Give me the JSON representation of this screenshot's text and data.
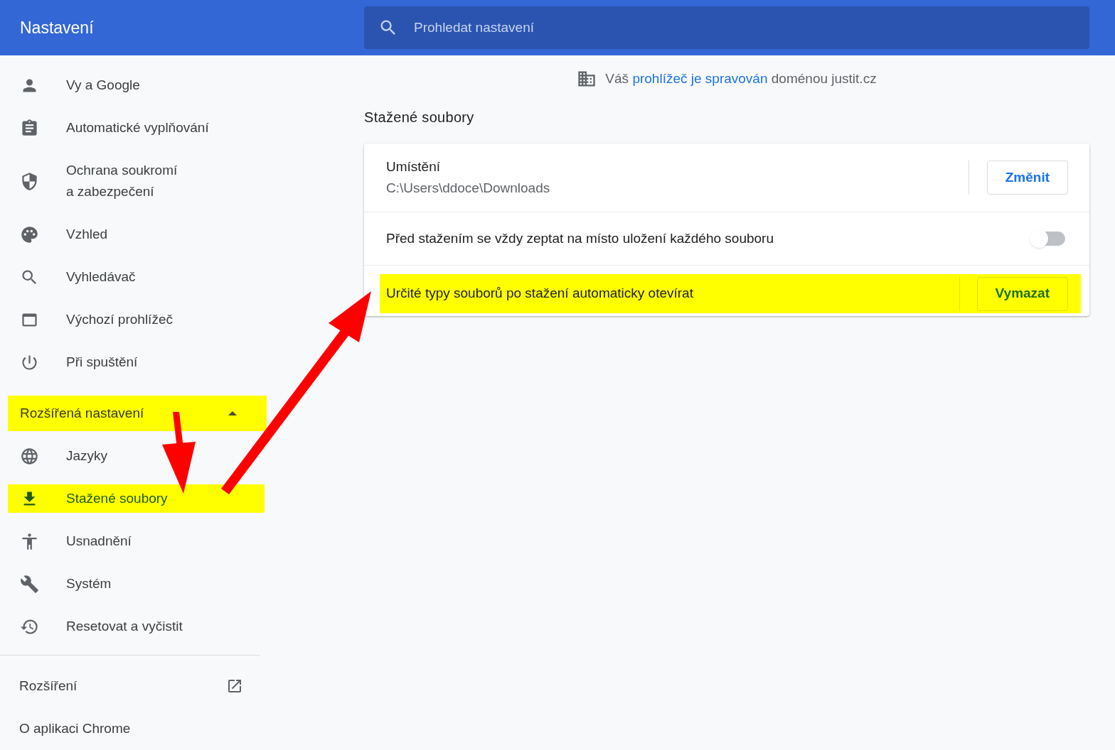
{
  "header": {
    "title": "Nastavení",
    "search": {
      "placeholder": "Prohledat nastavení"
    }
  },
  "sidebar": {
    "items": [
      {
        "label": "Vy a Google",
        "selected": false,
        "highlighted": false
      },
      {
        "label": "Automatické vyplňování",
        "selected": false,
        "highlighted": false
      },
      {
        "label": "Ochrana soukromí\na zabezpečení",
        "selected": false,
        "highlighted": false
      },
      {
        "label": "Vzhled",
        "selected": false,
        "highlighted": false
      },
      {
        "label": "Vyhledávač",
        "selected": false,
        "highlighted": false
      },
      {
        "label": "Výchozí prohlížeč",
        "selected": false,
        "highlighted": false
      },
      {
        "label": "Při spuštění",
        "selected": false,
        "highlighted": false
      }
    ],
    "advanced": {
      "label": "Rozšířená nastavení",
      "expanded": true,
      "highlighted": true
    },
    "advanced_items": [
      {
        "label": "Jazyky",
        "selected": false,
        "highlighted": false
      },
      {
        "label": "Stažené soubory",
        "selected": true,
        "highlighted": true
      },
      {
        "label": "Usnadnění",
        "selected": false,
        "highlighted": false
      },
      {
        "label": "Systém",
        "selected": false,
        "highlighted": false
      },
      {
        "label": "Resetovat a vyčistit",
        "selected": false,
        "highlighted": false
      }
    ],
    "footer_items": [
      {
        "label": "Rozšíření",
        "external": true
      },
      {
        "label": "O aplikaci Chrome",
        "external": false
      }
    ]
  },
  "managed_notice": {
    "prefix": "Váš",
    "link": "prohlížeč je spravován",
    "suffix": "doménou justit.cz"
  },
  "section": {
    "title": "Stažené soubory",
    "rows": [
      {
        "kind": "location",
        "label": "Umístění",
        "value": "C:\\Users\\ddoce\\Downloads",
        "button": "Změnit"
      },
      {
        "kind": "toggle",
        "label": "Před stažením se vždy zeptat na místo uložení každého souboru",
        "on": false
      },
      {
        "kind": "action",
        "label": "Určité typy souborů po stažení automaticky otevírat",
        "button": "Vymazat",
        "highlighted": true
      }
    ]
  }
}
